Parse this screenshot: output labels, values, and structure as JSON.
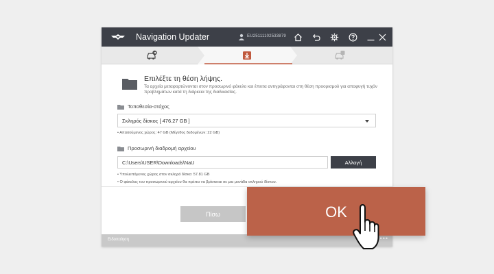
{
  "app": {
    "title": "Navigation Updater",
    "user_id": "EU25111102533879"
  },
  "steps": [
    {
      "name": "car-connect",
      "state": "done"
    },
    {
      "name": "download",
      "state": "active"
    },
    {
      "name": "car-install",
      "state": "pending"
    }
  ],
  "content": {
    "heading": "Επιλέξτε τη θέση λήψης.",
    "description": "Τα αρχεία μεταφορτώνονται στον προσωρινό φάκελο και έπειτα αντιγράφονται στη θέση προορισμού για αποφυγή τυχόν προβλημάτων κατά τη διάρκεια της διαδικασίας.",
    "target_label": "Τοποθεσία-στόχος",
    "target_value": "Σκληρός δίσκος [ 476.27 GB ]",
    "required_space": "• Απαιτούμενος χώρος: 47 GB (Μέγεθος δεδομένων: 22 GB)",
    "temp_label": "Προσωρινή διαδρομή αρχείου",
    "temp_path": "C:\\Users\\USER\\Downloads\\NaU",
    "change_button": "Αλλαγή",
    "remaining_space": "• Υπολειπόμενος χώρος στον σκληρό δίσκο: 57.81 GB",
    "temp_note": "• Ο φάκελος του προσωρινού αρχείου θα πρέπει να βρίσκεται σε μια μονάδα σκληρού δίσκου."
  },
  "buttons": {
    "back": "Πίσω",
    "ok": "OK"
  },
  "status": {
    "label": "Ειδοποίηση",
    "dots": "•••"
  },
  "colors": {
    "titlebar": "#3d4048",
    "accent": "#bb6249",
    "step_active": "#c0593e"
  }
}
